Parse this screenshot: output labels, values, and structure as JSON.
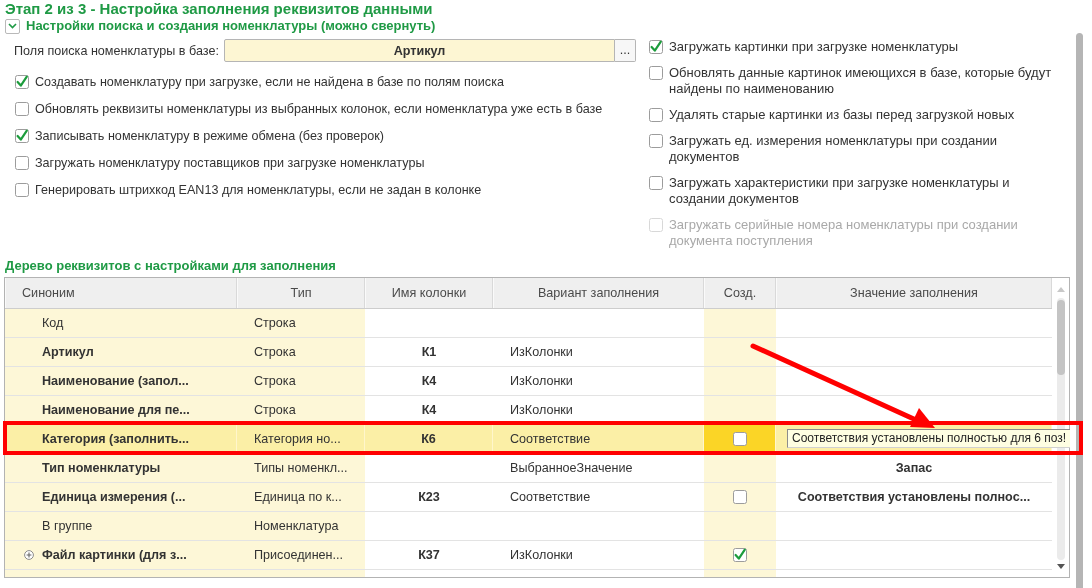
{
  "step_title": "Этап 2 из 3 - Настройка заполнения реквизитов данными",
  "search_section": {
    "title": "Настройки поиска и создания номенклатуры (можно свернуть)",
    "expanded": true,
    "search_fields": {
      "label": "Поля поиска номенклатуры в базе:",
      "value": "Артикул",
      "button": "..."
    },
    "left_options": [
      {
        "label": "Создавать номенклатуру при загрузке, если не найдена в базе по полям поиска",
        "checked": true,
        "disabled": false
      },
      {
        "label": "Обновлять реквизиты номенклатуры из выбранных колонок, если номенклатура уже есть в базе",
        "checked": false,
        "disabled": false
      },
      {
        "label": "Записывать номенклатуру в режиме обмена (без проверок)",
        "checked": true,
        "disabled": false
      },
      {
        "label": "Загружать номенклатуру поставщиков при загрузке номенклатуры",
        "checked": false,
        "disabled": false
      },
      {
        "label": "Генерировать штрихкод EAN13 для номенклатуры, если не задан в колонке",
        "checked": false,
        "disabled": false
      }
    ],
    "right_options": [
      {
        "label": "Загружать картинки при загрузке номенклатуры",
        "checked": true,
        "disabled": false
      },
      {
        "label": "Обновлять данные картинок имеющихся в базе, которые будут найдены по наименованию",
        "checked": false,
        "disabled": false
      },
      {
        "label": "Удалять старые картинки из базы перед загрузкой новых",
        "checked": false,
        "disabled": false
      },
      {
        "label": "Загружать ед. измерения номенклатуры при создании документов",
        "checked": false,
        "disabled": false
      },
      {
        "label": "Загружать характеристики при загрузке номенклатуры и создании документов",
        "checked": false,
        "disabled": false
      },
      {
        "label": "Загружать серийные номера номенклатуры при создании документа поступления",
        "checked": false,
        "disabled": true
      }
    ]
  },
  "tree": {
    "title": "Дерево реквизитов с настройками для заполнения",
    "columns": [
      "Синоним",
      "Тип",
      "Имя колонки",
      "Вариант заполнения",
      "Созд.",
      "Значение заполнения"
    ],
    "rows": [
      {
        "synonym": "Код",
        "bold": false,
        "has_children": false,
        "type": "Строка",
        "selected": false
      },
      {
        "synonym": "Артикул",
        "bold": true,
        "has_children": false,
        "type": "Строка",
        "column": "К1",
        "variant": "ИзКолонки",
        "selected": false
      },
      {
        "synonym": "Наименование (запол...",
        "bold": true,
        "has_children": false,
        "type": "Строка",
        "column": "К4",
        "variant": "ИзКолонки",
        "selected": false
      },
      {
        "synonym": "Наименование для пе...",
        "bold": true,
        "has_children": false,
        "type": "Строка",
        "column": "К4",
        "variant": "ИзКолонки",
        "selected": false
      },
      {
        "synonym": "Категория (заполнить...",
        "bold": true,
        "has_children": false,
        "type": "Категория но...",
        "column": "К6",
        "variant": "Соответствие",
        "create": {
          "checked": false
        },
        "value": "Соответствия установлены полностью для 6 поз!",
        "selected": true
      },
      {
        "synonym": "Тип номенклатуры",
        "bold": true,
        "has_children": false,
        "type": "Типы номенкл...",
        "variant": "ВыбранноеЗначение",
        "value": "Запас",
        "selected": false
      },
      {
        "synonym": "Единица измерения (...",
        "bold": true,
        "has_children": false,
        "type": "Единица по к...",
        "column": "К23",
        "variant": "Соответствие",
        "create": {
          "checked": false
        },
        "value": "Соответствия установлены полнос...",
        "selected": false
      },
      {
        "synonym": "В группе",
        "bold": false,
        "has_children": false,
        "type": "Номенклатура",
        "selected": false
      },
      {
        "synonym": "Файл картинки (для з...",
        "bold": true,
        "has_children": true,
        "type": "Присоединен...",
        "column": "К37",
        "variant": "ИзКолонки",
        "create": {
          "checked": true
        },
        "selected": false
      }
    ]
  }
}
